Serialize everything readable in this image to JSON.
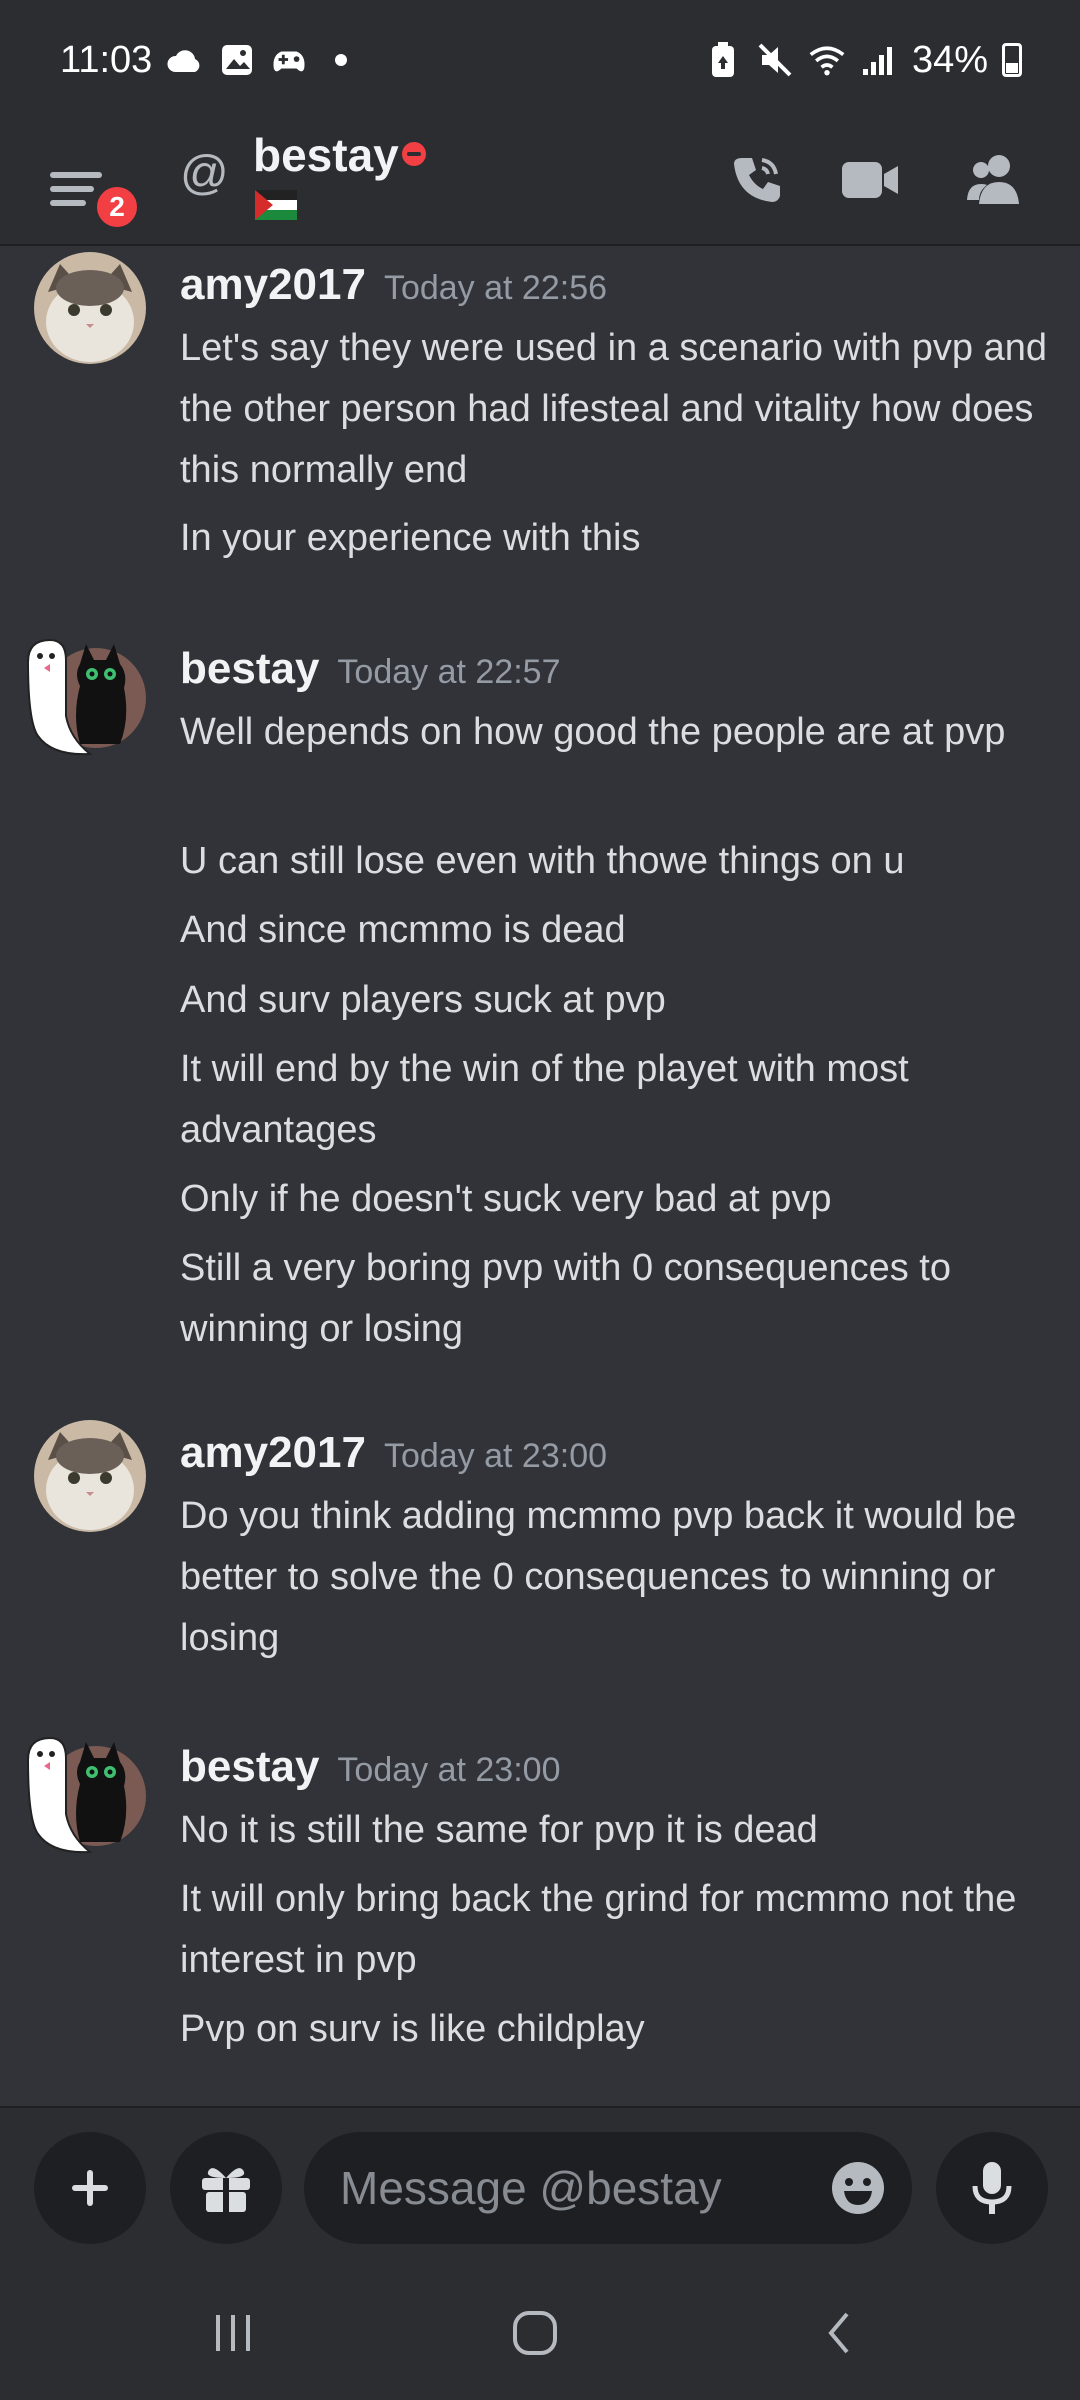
{
  "status_bar": {
    "time": "11:03",
    "battery": "34%",
    "left_icons": [
      "cloud-icon",
      "image-icon",
      "game-controller-icon",
      "dot-icon"
    ],
    "right_icons": [
      "battery-saver-icon",
      "mute-icon",
      "wifi-icon",
      "signal-icon",
      "battery-icon"
    ]
  },
  "header": {
    "unread_count": "2",
    "dm_name": "bestay",
    "status": "dnd",
    "icons": [
      "call-icon",
      "video-icon",
      "members-icon"
    ]
  },
  "messages": [
    {
      "author": "amy2017",
      "timestamp": "Today at 22:56",
      "avatar": "cat-photo-avatar",
      "lines": [
        "Let's say they were used in a scenario with pvp and the other person had lifesteal and vitality how does this normally end",
        "In your experience with this"
      ]
    },
    {
      "author": "bestay",
      "timestamp": "Today at 22:57",
      "avatar": "black-cat-avatar",
      "lines": [
        "Well depends on how good the people are at pvp",
        "U can still lose even with thowe things on u",
        "And since mcmmo is dead",
        "And surv players suck at pvp",
        "It will end by the win of the playet with most advantages",
        "Only if he doesn't suck very bad at pvp",
        "Still a very boring pvp with 0 consequences to winning or losing"
      ]
    },
    {
      "author": "amy2017",
      "timestamp": "Today at 23:00",
      "avatar": "cat-photo-avatar",
      "lines": [
        "Do you think adding mcmmo pvp back it would be better to solve the 0 consequences to winning or losing"
      ]
    },
    {
      "author": "bestay",
      "timestamp": "Today at 23:00",
      "avatar": "black-cat-avatar",
      "lines": [
        "No it is still the same for pvp it is dead",
        "It will only bring back the grind for mcmmo not the interest in pvp",
        "Pvp on surv is like childplay"
      ]
    }
  ],
  "composer": {
    "placeholder": "Message @bestay",
    "icons": [
      "plus-icon",
      "gift-icon",
      "emoji-icon",
      "microphone-icon"
    ]
  },
  "nav_bar": {
    "icons": [
      "recents-icon",
      "home-icon",
      "back-icon"
    ]
  },
  "colors": {
    "background": "#313338",
    "header": "#2b2d31",
    "input": "#1e1f22",
    "badge": "#f23f43",
    "timestamp": "#949ba4"
  }
}
